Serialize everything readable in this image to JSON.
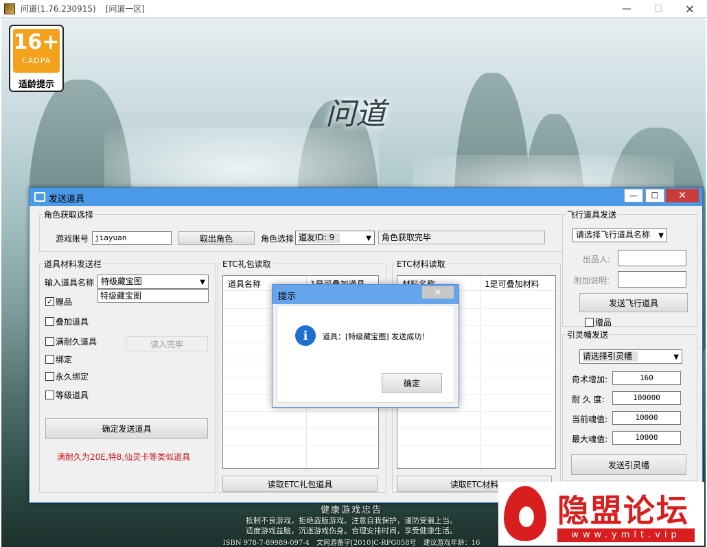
{
  "game_window": {
    "title": "问道(1.76.230915)",
    "server": "[问道一区]",
    "min_glyph": "—",
    "max_glyph": "☐",
    "close_glyph": "✕"
  },
  "age_badge": {
    "number": "16+",
    "org": "CADPA",
    "tip": "适龄提示"
  },
  "logo_text": "问道",
  "footer_notice": {
    "title": "健康游戏忠告",
    "line1": "抵制不良游戏，拒绝盗版游戏。注意自我保护，谨防受骗上当。",
    "line2": "适度游戏益脑，沉迷游戏伤身。合理安排时间，享受健康生活。",
    "isbn": "ISBN 978-7-89989-097-4　文网游备字[2010]C-RPG058号　建议游戏年龄：16"
  },
  "watermark": {
    "title": "隐盟论坛",
    "url": "www.ymlt.vip"
  },
  "tool_window": {
    "title": "发送道具",
    "min_glyph": "—",
    "max_glyph": "☐",
    "close_glyph": "✕",
    "role_group": {
      "legend": "角色获取选择",
      "account_label": "游戏账号",
      "account_value": "jiayuan",
      "fetch_button": "取出角色",
      "role_label": "角色选择",
      "role_selected": "道友ID: 9",
      "status_text": "角色获取完毕"
    },
    "item_group": {
      "legend": "道具材料发送栏",
      "item_name_label": "输入道具名称",
      "item_selected": "特级藏宝图",
      "item_suggestion": "特级藏宝图",
      "checkboxes": [
        {
          "label": "赠品",
          "checked": true
        },
        {
          "label": "叠加道具",
          "checked": false
        },
        {
          "label": "满耐久道具",
          "checked": false
        },
        {
          "label": "绑定",
          "checked": false
        },
        {
          "label": "永久绑定",
          "checked": false
        },
        {
          "label": "等级道具",
          "checked": false
        }
      ],
      "read_done_button": "读入完毕",
      "confirm_button": "确定发送道具",
      "hint_text": "满耐久为20E,特8,仙灵卡等类似道具",
      "hint_color": "#c8161d"
    },
    "etc_gift": {
      "legend": "ETC礼包读取",
      "columns": [
        "道具名称",
        "1是可叠加道具"
      ],
      "read_button": "读取ETC礼包道具"
    },
    "etc_material": {
      "legend": "ETC材料读取",
      "columns": [
        "材料名称",
        "1是可叠加材料"
      ],
      "read_button": "读取ETC材料"
    },
    "flight_group": {
      "legend": "飞行道具发送",
      "select_placeholder": "请选择飞行道具名称",
      "producer_label": "出品人:",
      "producer_value": "",
      "note_label": "附加说明:",
      "note_value": "",
      "send_button": "发送飞行道具",
      "gift_label": "赠品",
      "gift_checked": false
    },
    "banner_group": {
      "legend": "引灵幡发送",
      "select_placeholder": "请选择引灵幡",
      "fields": [
        {
          "label": "奇术增加:",
          "value": "160"
        },
        {
          "label": "耐 久 度:",
          "value": "100000"
        },
        {
          "label": "当前魂值:",
          "value": "10000"
        },
        {
          "label": "最大魂值:",
          "value": "10000"
        }
      ],
      "send_button": "发送引灵幡"
    }
  },
  "dialog": {
    "title": "提示",
    "close_glyph": "✕",
    "info_glyph": "i",
    "message": "道具：[特级藏宝图] 发送成功！",
    "ok_button": "确定"
  },
  "colors": {
    "accent": "#4a9ae8",
    "close_red": "#c83c3c",
    "info_blue": "#1f6fd1"
  }
}
